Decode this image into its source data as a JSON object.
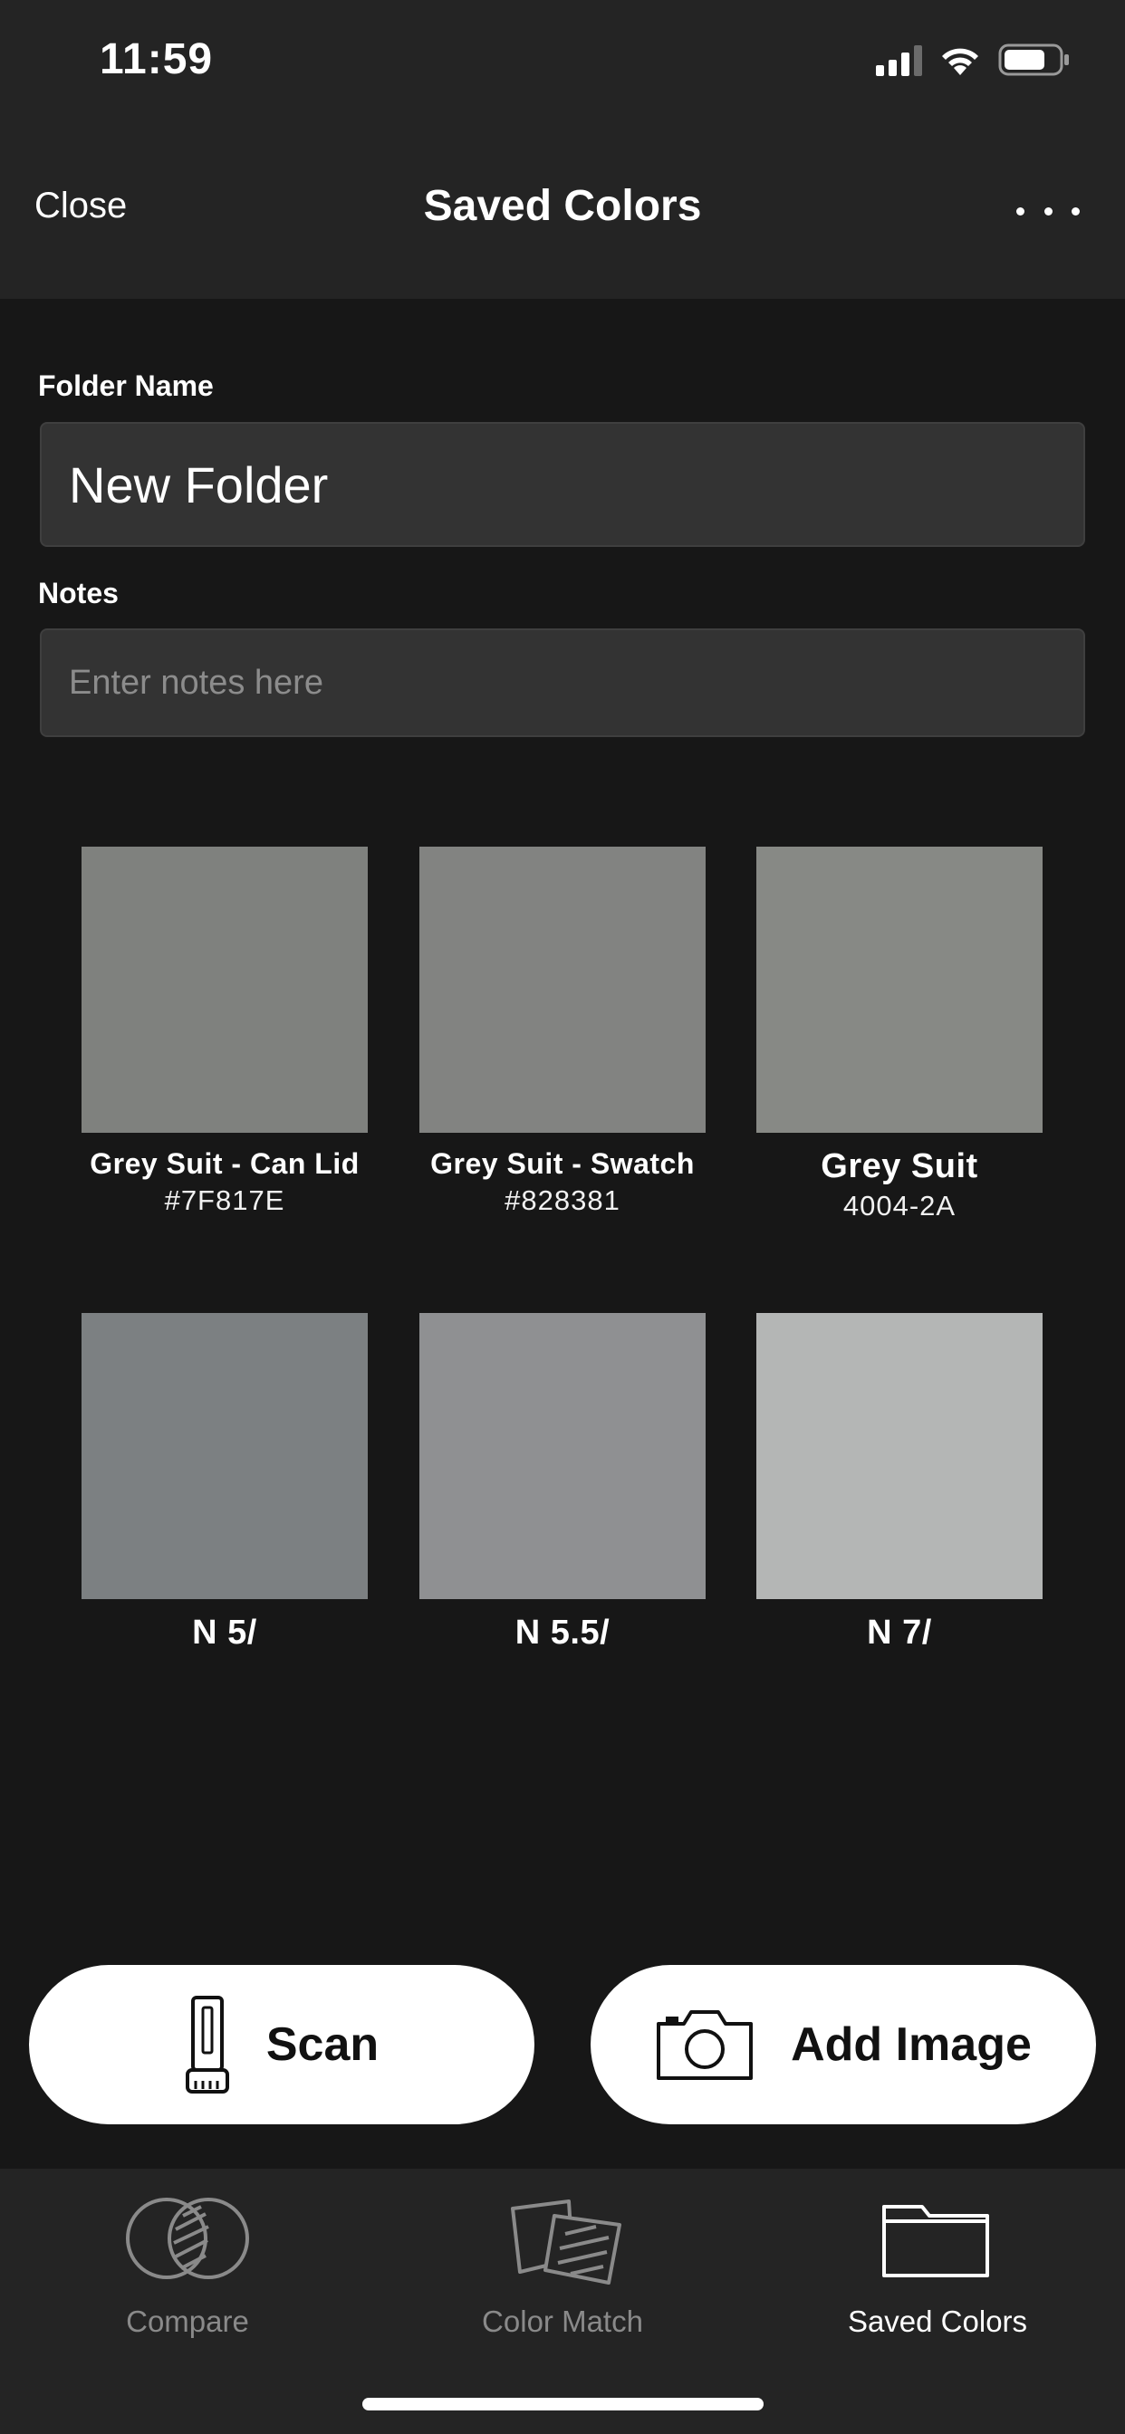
{
  "status_bar": {
    "time": "11:59"
  },
  "header": {
    "close_label": "Close",
    "title": "Saved Colors"
  },
  "form": {
    "folder_label": "Folder Name",
    "folder_value": "New Folder",
    "notes_label": "Notes",
    "notes_placeholder": "Enter notes here"
  },
  "swatches": [
    {
      "name": "Grey Suit - Can Lid",
      "code": "#7F817E",
      "color": "#7F817E"
    },
    {
      "name": "Grey Suit - Swatch",
      "code": "#828381",
      "color": "#828381"
    },
    {
      "name": "Grey Suit",
      "code": "4004-2A",
      "color": "#878985"
    },
    {
      "name": "N 5/",
      "code": "",
      "color": "#7c8082"
    },
    {
      "name": "N 5.5/",
      "code": "",
      "color": "#8f9092"
    },
    {
      "name": "N 7/",
      "code": "",
      "color": "#b4b6b5"
    }
  ],
  "actions": {
    "scan_label": "Scan",
    "add_image_label": "Add Image"
  },
  "tabs": [
    {
      "label": "Compare",
      "icon": "compare-icon",
      "active": false
    },
    {
      "label": "Color Match",
      "icon": "color-match-icon",
      "active": false
    },
    {
      "label": "Saved Colors",
      "icon": "folder-icon",
      "active": true
    }
  ]
}
